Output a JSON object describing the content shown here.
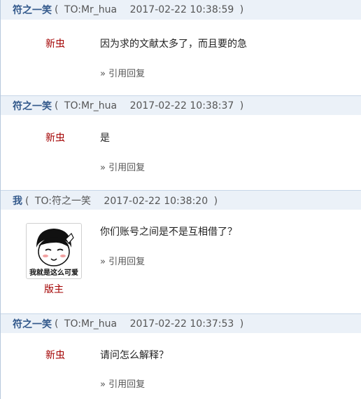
{
  "posts": [
    {
      "author": "符之一笑",
      "to": "TO:Mr_hua",
      "time": "2017-02-22 10:38:59",
      "role": "新虫",
      "message": "因为求的文献太多了，而且要的急",
      "quote": "» 引用回复"
    },
    {
      "author": "符之一笑",
      "to": "TO:Mr_hua",
      "time": "2017-02-22 10:38:37",
      "role": "新虫",
      "message": "是",
      "quote": "» 引用回复"
    },
    {
      "author": "我",
      "to": "TO:符之一笑",
      "time": "2017-02-22 10:38:20",
      "role": "版主",
      "message": "你们账号之间是不是互相借了？",
      "quote": "» 引用回复",
      "avatar_caption": "我就是这么可爱"
    },
    {
      "author": "符之一笑",
      "to": "TO:Mr_hua",
      "time": "2017-02-22 10:37:53",
      "role": "新虫",
      "message": "请问怎么解释？",
      "quote": "» 引用回复"
    }
  ],
  "symbols": {
    "open_paren": "(",
    "close_paren": ")"
  },
  "colors": {
    "header_bg": "#ebf1f8",
    "author": "#345a8c",
    "role": "#a30000"
  }
}
